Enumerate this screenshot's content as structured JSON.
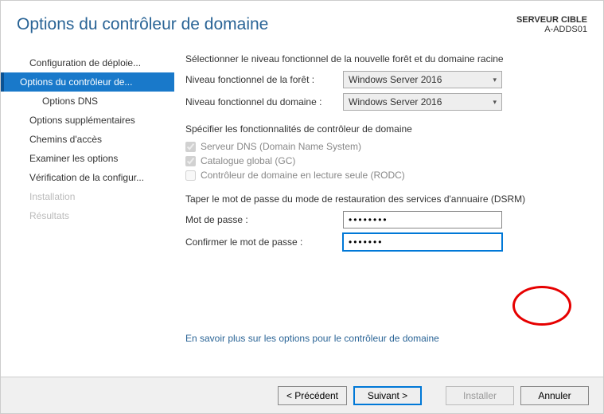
{
  "header": {
    "title": "Options du contrôleur de domaine",
    "target_label": "SERVEUR CIBLE",
    "target_name": "A-ADDS01"
  },
  "sidebar": {
    "items": [
      {
        "label": "Configuration de déploie...",
        "selected": false,
        "child": false,
        "disabled": false
      },
      {
        "label": "Options du contrôleur de...",
        "selected": true,
        "child": false,
        "disabled": false
      },
      {
        "label": "Options DNS",
        "selected": false,
        "child": true,
        "disabled": false
      },
      {
        "label": "Options supplémentaires",
        "selected": false,
        "child": false,
        "disabled": false
      },
      {
        "label": "Chemins d'accès",
        "selected": false,
        "child": false,
        "disabled": false
      },
      {
        "label": "Examiner les options",
        "selected": false,
        "child": false,
        "disabled": false
      },
      {
        "label": "Vérification de la configur...",
        "selected": false,
        "child": false,
        "disabled": false
      },
      {
        "label": "Installation",
        "selected": false,
        "child": false,
        "disabled": true
      },
      {
        "label": "Résultats",
        "selected": false,
        "child": false,
        "disabled": true
      }
    ]
  },
  "content": {
    "intro": "Sélectionner le niveau fonctionnel de la nouvelle forêt et du domaine racine",
    "forest_label": "Niveau fonctionnel de la forêt :",
    "forest_value": "Windows Server 2016",
    "domain_label": "Niveau fonctionnel du domaine :",
    "domain_value": "Windows Server 2016",
    "capabilities_head": "Spécifier les fonctionnalités de contrôleur de domaine",
    "cb_dns": "Serveur DNS (Domain Name System)",
    "cb_gc": "Catalogue global (GC)",
    "cb_rodc": "Contrôleur de domaine en lecture seule (RODC)",
    "dsrm_head": "Taper le mot de passe du mode de restauration des services d'annuaire (DSRM)",
    "pw_label": "Mot de passe :",
    "pw_confirm_label": "Confirmer le mot de passe :",
    "pw_value": "••••••••",
    "pw_confirm_value": "•••••••",
    "more_link": "En savoir plus sur les options pour le contrôleur de domaine"
  },
  "footer": {
    "prev": "< Précédent",
    "next": "Suivant >",
    "install": "Installer",
    "cancel": "Annuler"
  }
}
